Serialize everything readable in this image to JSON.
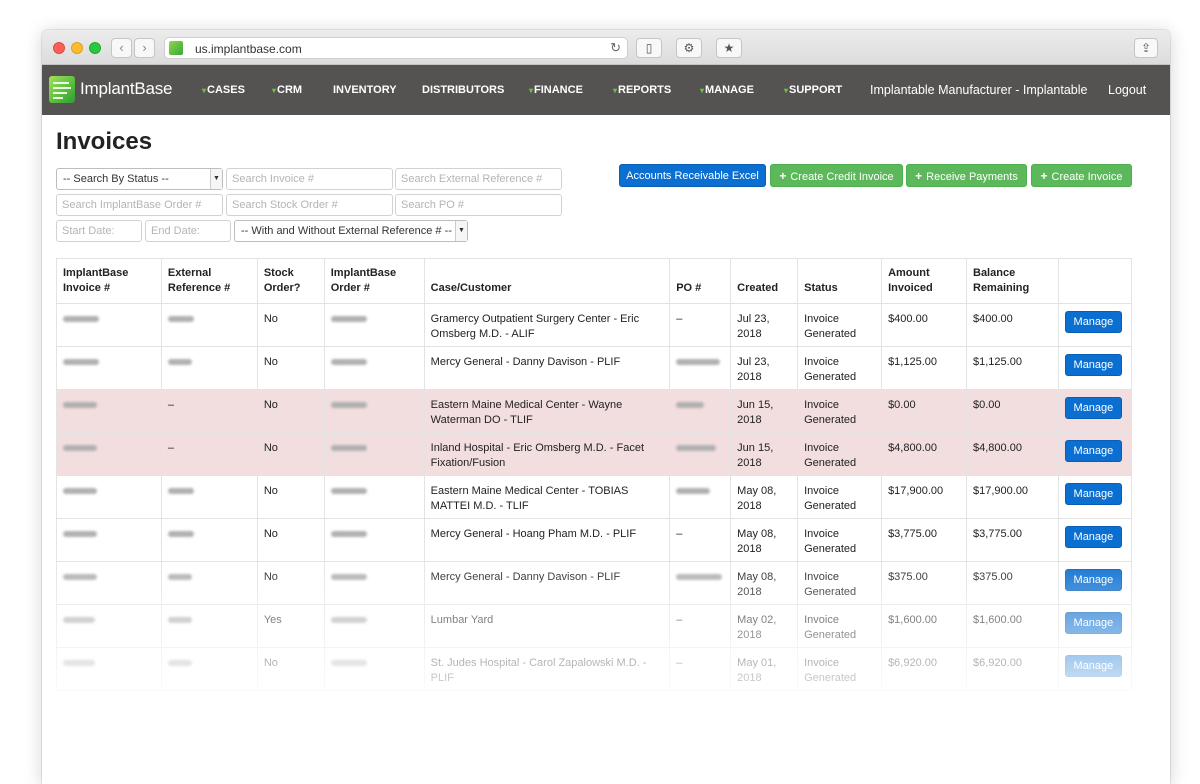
{
  "browser": {
    "url": "us.implantbase.com",
    "back_icon": "chevron-left-icon",
    "forward_icon": "chevron-right-icon",
    "reload_icon": "reload-icon",
    "share_icon": "share-icon"
  },
  "nav": {
    "logo_text": "ImplantBase",
    "items": [
      "CASES",
      "CRM",
      "INVENTORY",
      "DISTRIBUTORS",
      "FINANCE",
      "REPORTS",
      "MANAGE",
      "SUPPORT"
    ],
    "account": "Implantable Manufacturer - Implantable",
    "logout": "Logout",
    "accent": "#67c04a",
    "bg": "#555352"
  },
  "page": {
    "title": "Invoices"
  },
  "filters": {
    "status_select": "-- Search By Status --",
    "invoice_placeholder": "Search Invoice #",
    "external_ref_placeholder": "Search External Reference #",
    "order_placeholder": "Search ImplantBase Order #",
    "stock_order_placeholder": "Search Stock Order #",
    "po_placeholder": "Search PO #",
    "start_date_placeholder": "Start Date:",
    "end_date_placeholder": "End Date:",
    "external_ref_select": "-- With and Without External Reference # --"
  },
  "actions": {
    "ar_excel": "Accounts Receivable Excel",
    "create_credit": "Create Credit Invoice",
    "receive_payments": "Receive Payments",
    "create_invoice": "Create Invoice",
    "primary_color": "#0a6fd1",
    "success_color": "#5db85c"
  },
  "table": {
    "headers": [
      "ImplantBase Invoice #",
      "External Reference #",
      "Stock Order?",
      "ImplantBase Order #",
      "Case/Customer",
      "PO #",
      "Created",
      "Status",
      "Amount Invoiced",
      "Balance Remaining",
      ""
    ],
    "manage_label": "Manage",
    "highlight_color": "#f2dede",
    "rows": [
      {
        "ext_ref": "",
        "stock": "No",
        "customer": "Gramercy Outpatient Surgery Center - Eric Omsberg M.D. - ALIF",
        "po": "–",
        "created": "Jul 23, 2018",
        "status": "Invoice Generated",
        "amount": "$400.00",
        "balance": "$400.00"
      },
      {
        "ext_ref": "",
        "stock": "No",
        "customer": "Mercy General - Danny Davison - PLIF",
        "po": "",
        "created": "Jul 23, 2018",
        "status": "Invoice Generated",
        "amount": "$1,125.00",
        "balance": "$1,125.00"
      },
      {
        "ext_ref": "–",
        "stock": "No",
        "customer": "Eastern Maine Medical Center - Wayne Waterman DO - TLIF",
        "po": "",
        "created": "Jun 15, 2018",
        "status": "Invoice Generated",
        "amount": "$0.00",
        "balance": "$0.00"
      },
      {
        "ext_ref": "–",
        "stock": "No",
        "customer": "Inland Hospital - Eric Omsberg M.D. - Facet Fixation/Fusion",
        "po": "",
        "created": "Jun 15, 2018",
        "status": "Invoice Generated",
        "amount": "$4,800.00",
        "balance": "$4,800.00"
      },
      {
        "ext_ref": "",
        "stock": "No",
        "customer": "Eastern Maine Medical Center - TOBIAS MATTEI M.D. - TLIF",
        "po": "",
        "created": "May 08, 2018",
        "status": "Invoice Generated",
        "amount": "$17,900.00",
        "balance": "$17,900.00"
      },
      {
        "ext_ref": "",
        "stock": "No",
        "customer": "Mercy General - Hoang Pham M.D. - PLIF",
        "po": "–",
        "created": "May 08, 2018",
        "status": "Invoice Generated",
        "amount": "$3,775.00",
        "balance": "$3,775.00"
      },
      {
        "ext_ref": "",
        "stock": "No",
        "customer": "Mercy General - Danny Davison - PLIF",
        "po": "",
        "created": "May 08, 2018",
        "status": "Invoice Generated",
        "amount": "$375.00",
        "balance": "$375.00"
      },
      {
        "ext_ref": "",
        "stock": "Yes",
        "customer": "Lumbar Yard",
        "po": "–",
        "created": "May 02, 2018",
        "status": "Invoice Generated",
        "amount": "$1,600.00",
        "balance": "$1,600.00"
      },
      {
        "ext_ref": "",
        "stock": "No",
        "customer": "St. Judes Hospital - Carol Zapalowski M.D. - PLIF",
        "po": "–",
        "created": "May 01, 2018",
        "status": "Invoice Generated",
        "amount": "$6,920.00",
        "balance": "$6,920.00"
      }
    ]
  }
}
